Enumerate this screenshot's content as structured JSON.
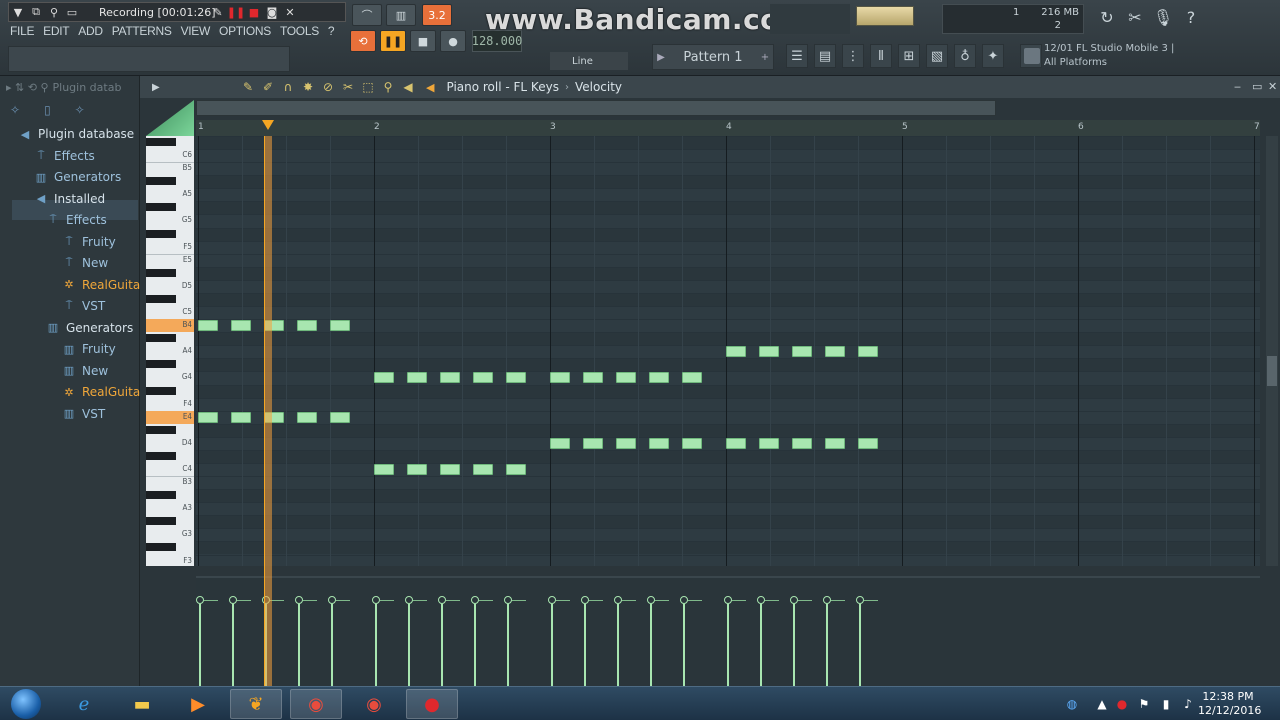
{
  "recorder": {
    "status_text": "Recording [00:01:26]"
  },
  "watermark": "www.Bandicam.com",
  "menu": [
    "FILE",
    "EDIT",
    "ADD",
    "PATTERNS",
    "VIEW",
    "OPTIONS",
    "TOOLS",
    "?"
  ],
  "transport": {
    "tempo": "128.000",
    "time_sig_badge": "3.2",
    "snap": "Line"
  },
  "pattern": {
    "name": "Pattern 1"
  },
  "performance": {
    "cpu_value": "1",
    "memory": "216 MB",
    "polyphony": "2"
  },
  "news": {
    "line1": "12/01  FL Studio Mobile 3 |",
    "line2": "All Platforms"
  },
  "browser": {
    "header": "Plugin datab",
    "items": [
      {
        "label": "Plugin database",
        "level": 0,
        "icon": "speaker-icon",
        "head": true
      },
      {
        "label": "Effects",
        "level": 1,
        "icon": "plug-icon"
      },
      {
        "label": "Generators",
        "level": 1,
        "icon": "folder-icon"
      },
      {
        "label": "Installed",
        "level": 1,
        "icon": "speaker-icon",
        "head": true
      },
      {
        "label": "Effects",
        "level": 2,
        "icon": "plug-icon"
      },
      {
        "label": "Fruity",
        "level": 3,
        "icon": "plug-icon"
      },
      {
        "label": "New",
        "level": 3,
        "icon": "plug-icon"
      },
      {
        "label": "RealGuitar",
        "level": 3,
        "icon": "gear-icon",
        "highlight": true
      },
      {
        "label": "VST",
        "level": 3,
        "icon": "plug-icon"
      },
      {
        "label": "Generators",
        "level": 2,
        "icon": "folder-icon",
        "head": true
      },
      {
        "label": "Fruity",
        "level": 3,
        "icon": "folder-icon"
      },
      {
        "label": "New",
        "level": 3,
        "icon": "folder-icon"
      },
      {
        "label": "RealGuitar",
        "level": 3,
        "icon": "gear-icon",
        "highlight": true
      },
      {
        "label": "VST",
        "level": 3,
        "icon": "folder-icon"
      }
    ]
  },
  "piano_roll": {
    "title": "Piano roll - FL Keys",
    "mode": "Velocity",
    "bars": [
      "1",
      "2",
      "3",
      "4",
      "5",
      "6",
      "7"
    ],
    "key_labels": [
      "C6",
      "B5",
      "A5",
      "G5",
      "F5",
      "E5",
      "D5",
      "C5",
      "B4",
      "A4",
      "G4",
      "F4",
      "E4",
      "D4",
      "C4",
      "B3",
      "A3",
      "G3",
      "F3"
    ],
    "highlighted_keys": [
      "B4",
      "E4"
    ],
    "notes": [
      {
        "pitch": "B4",
        "beats": [
          0,
          0.75,
          1.5,
          2.25,
          3
        ]
      },
      {
        "pitch": "E4",
        "beats": [
          0,
          0.75,
          1.5,
          2.25,
          3
        ]
      },
      {
        "pitch": "G4",
        "beats": [
          4,
          4.75,
          5.5,
          6.25,
          7,
          8,
          8.75,
          9.5,
          10.25,
          11
        ]
      },
      {
        "pitch": "C4",
        "beats": [
          4,
          4.75,
          5.5,
          6.25,
          7
        ]
      },
      {
        "pitch": "D4",
        "beats": [
          8,
          8.75,
          9.5,
          10.25,
          11,
          12,
          12.75,
          13.5,
          14.25,
          15
        ]
      },
      {
        "pitch": "A4",
        "beats": [
          12,
          12.75,
          13.5,
          14.25,
          15
        ]
      }
    ],
    "note_length_beats": 0.5,
    "playhead_beat": 1.6
  },
  "taskbar": {
    "apps": [
      "windows-start",
      "internet-explorer-icon",
      "file-explorer-icon",
      "media-player-icon",
      "fl-studio-icon",
      "chrome-icon",
      "chrome-icon",
      "bandicam-icon"
    ],
    "clock_time": "12:38 PM",
    "clock_date": "12/12/2016"
  },
  "colors": {
    "note_fill": "#a8e6b0",
    "playhead": "#f5a623",
    "key_highlight": "#f4a95a",
    "browser_highlight": "#f0a73a"
  }
}
